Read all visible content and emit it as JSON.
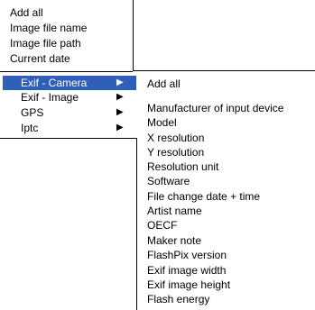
{
  "top_menu": {
    "items": [
      {
        "label": "Add all"
      },
      {
        "label": "Image file name"
      },
      {
        "label": "Image file path"
      },
      {
        "label": "Current date"
      }
    ]
  },
  "submenu_parent": {
    "items": [
      {
        "label": "Exif - Camera",
        "selected": true,
        "arrow": "▶"
      },
      {
        "label": "Exif - Image",
        "selected": false,
        "arrow": "▶"
      },
      {
        "label": "GPS",
        "selected": false,
        "arrow": "▶"
      },
      {
        "label": "Iptc",
        "selected": false,
        "arrow": "▶"
      }
    ]
  },
  "camera_submenu": {
    "add_all": "Add all",
    "items": [
      {
        "label": "Manufacturer of input device"
      },
      {
        "label": "Model"
      },
      {
        "label": "X resolution"
      },
      {
        "label": "Y resolution"
      },
      {
        "label": "Resolution unit"
      },
      {
        "label": "Software"
      },
      {
        "label": "File change date + time"
      },
      {
        "label": "Artist name"
      },
      {
        "label": "OECF"
      },
      {
        "label": "Maker note"
      },
      {
        "label": "FlashPix version"
      },
      {
        "label": "Exif image width"
      },
      {
        "label": "Exif image height"
      },
      {
        "label": "Flash energy"
      }
    ]
  },
  "colors": {
    "selection": "#2f5fb8",
    "selection_text": "#ffffff",
    "text": "#000000",
    "background": "#ffffff"
  }
}
